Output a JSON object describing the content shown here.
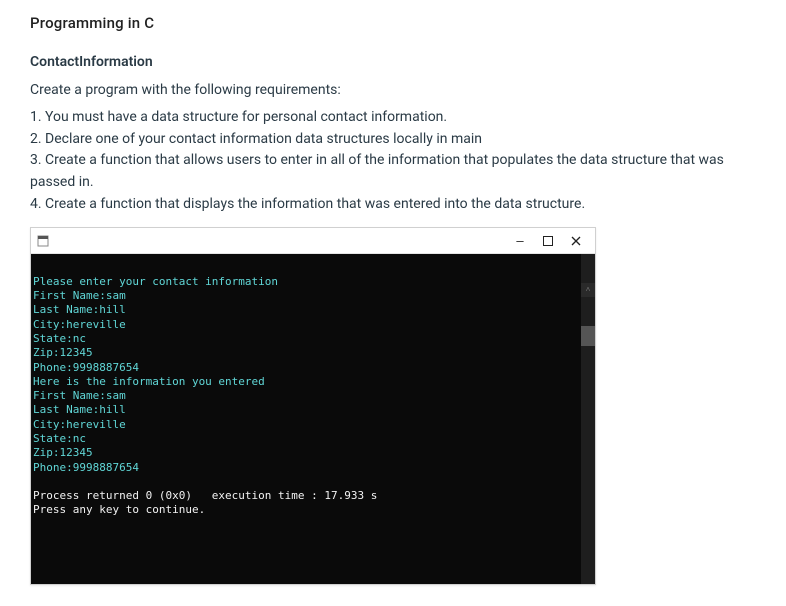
{
  "title": "Programming in C",
  "subtitle": "ContactInformation",
  "intro": "Create a program with the following requirements:",
  "requirements": [
    "1. You must have a data structure for personal contact information.",
    "2. Declare one of your contact information data structures locally in main",
    "3. Create a function that allows users to enter in all of the information that populates the data structure that was passed in.",
    "4. Create a function that displays the information that was entered into the data structure."
  ],
  "console": {
    "titlebar": {
      "minimize": "–",
      "maximize": "▢",
      "close": "✕"
    },
    "lines": [
      {
        "cls": "cyan",
        "text": "Please enter your contact information"
      },
      {
        "cls": "cyan",
        "text": "First Name:sam"
      },
      {
        "cls": "cyan",
        "text": "Last Name:hill"
      },
      {
        "cls": "cyan",
        "text": "City:hereville"
      },
      {
        "cls": "cyan",
        "text": "State:nc"
      },
      {
        "cls": "cyan",
        "text": "Zip:12345"
      },
      {
        "cls": "cyan",
        "text": "Phone:9998887654"
      },
      {
        "cls": "cyan",
        "text": "Here is the information you entered"
      },
      {
        "cls": "cyan",
        "text": "First Name:sam"
      },
      {
        "cls": "cyan",
        "text": "Last Name:hill"
      },
      {
        "cls": "cyan",
        "text": "City:hereville"
      },
      {
        "cls": "cyan",
        "text": "State:nc"
      },
      {
        "cls": "cyan",
        "text": "Zip:12345"
      },
      {
        "cls": "cyan",
        "text": "Phone:9998887654"
      },
      {
        "cls": "",
        "text": ""
      },
      {
        "cls": "white",
        "text": "Process returned 0 (0x0)   execution time : 17.933 s"
      },
      {
        "cls": "white",
        "text": "Press any key to continue."
      }
    ],
    "scroll_up": "˄"
  }
}
